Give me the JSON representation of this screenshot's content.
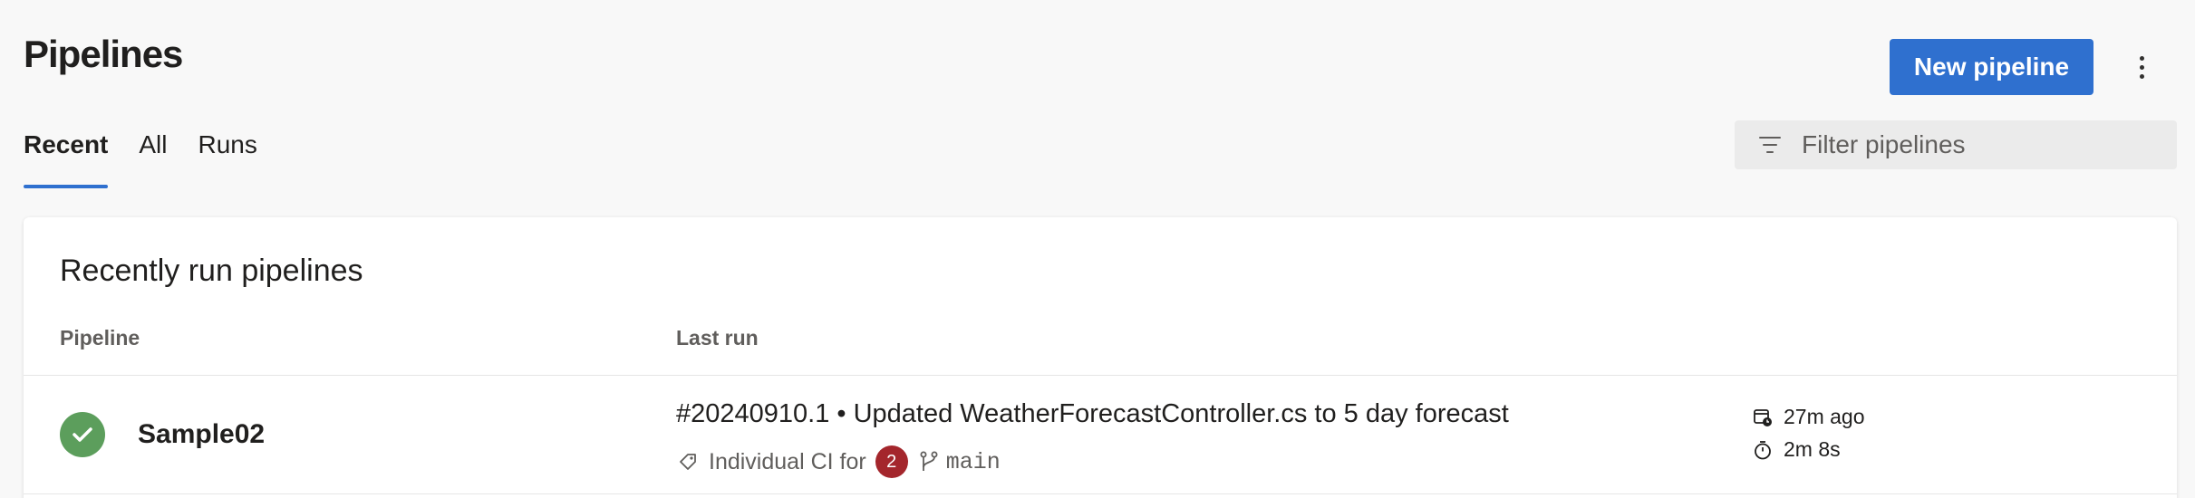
{
  "page": {
    "title": "Pipelines"
  },
  "header": {
    "new_button_label": "New pipeline",
    "more_icon": "more-vertical-icon"
  },
  "tabs": [
    {
      "label": "Recent",
      "active": true
    },
    {
      "label": "All",
      "active": false
    },
    {
      "label": "Runs",
      "active": false
    }
  ],
  "filter": {
    "placeholder": "Filter pipelines",
    "value": "",
    "icon": "filter-icon"
  },
  "section": {
    "title": "Recently run pipelines",
    "columns": {
      "pipeline": "Pipeline",
      "last_run": "Last run"
    }
  },
  "rows": [
    {
      "status": "succeeded",
      "status_icon": "check-circle-icon",
      "name": "Sample02",
      "run_title": "#20240910.1 • Updated WeatherForecastController.cs to 5 day forecast",
      "trigger": "Individual CI for",
      "trigger_count": "2",
      "branch": "main",
      "ago": "27m ago",
      "duration": "2m 8s"
    }
  ],
  "colors": {
    "accent": "#2f70cf",
    "success": "#5c9e5c",
    "badge": "#a4262c",
    "background": "#f8f8f8"
  }
}
